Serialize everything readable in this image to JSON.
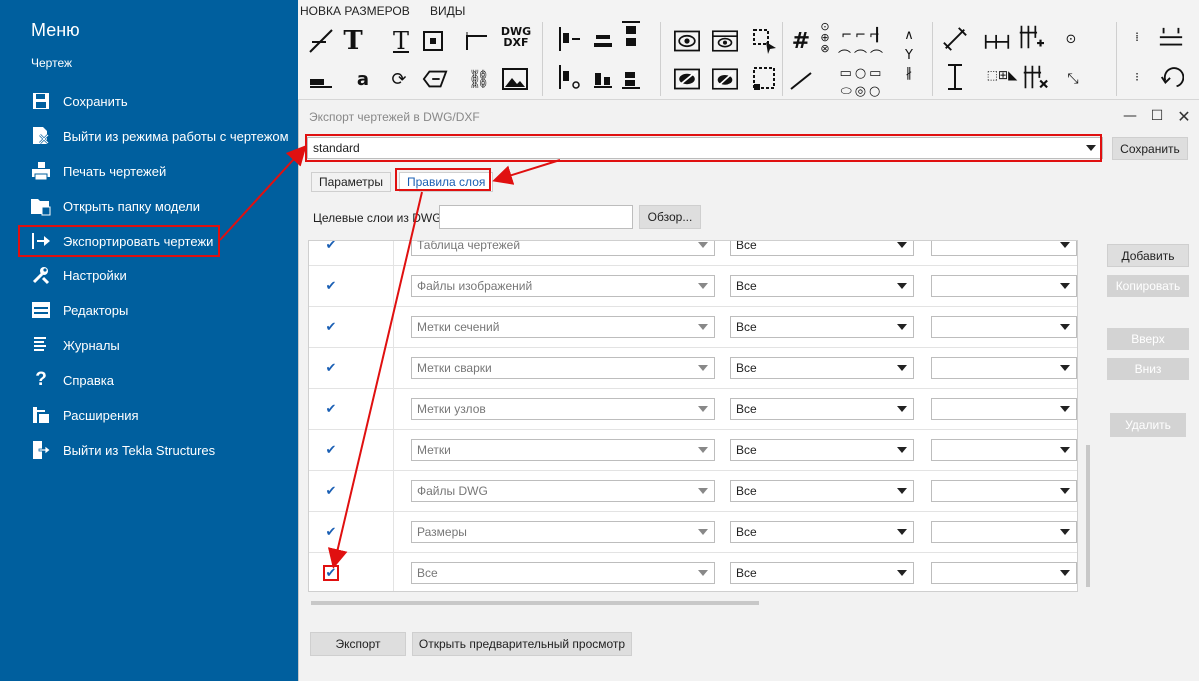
{
  "sidebar": {
    "title": "Меню",
    "section": "Чертеж",
    "items": [
      {
        "label": "Сохранить",
        "icon": "save-icon"
      },
      {
        "label": "Выйти из режима работы с чертежом",
        "icon": "exit-drawing-icon"
      },
      {
        "label": "Печать чертежей",
        "icon": "print-icon"
      },
      {
        "label": "Открыть папку модели",
        "icon": "folder-icon"
      },
      {
        "label": "Экспортировать чертежи",
        "icon": "export-icon"
      },
      {
        "label": "Настройки",
        "icon": "wrench-icon"
      },
      {
        "label": "Редакторы",
        "icon": "editors-icon"
      },
      {
        "label": "Журналы",
        "icon": "journal-icon"
      },
      {
        "label": "Справка",
        "icon": "question-icon"
      },
      {
        "label": "Расширения",
        "icon": "extensions-icon"
      },
      {
        "label": "Выйти из Tekla Structures",
        "icon": "exit-app-icon"
      }
    ]
  },
  "ribbon": {
    "tabs": [
      "НОВКА РАЗМЕРОВ",
      "ВИДЫ"
    ],
    "dwg_label": "DWG\nDXF"
  },
  "dialog": {
    "title": "Экспорт чертежей в DWG/DXF",
    "settings_value": "standard",
    "save_label": "Сохранить",
    "tabs": [
      "Параметры",
      "Правила слоя"
    ],
    "target_layers_label": "Целевые слои из DWG",
    "target_layers_value": "",
    "browse_label": "Обзор...",
    "side_buttons": {
      "add": "Добавить",
      "copy": "Копировать",
      "up": "Вверх",
      "down": "Вниз",
      "delete": "Удалить"
    },
    "rows": [
      {
        "checked": true,
        "rule": "Таблица чертежей",
        "scope": "Все",
        "extra": ""
      },
      {
        "checked": true,
        "rule": "Файлы изображений",
        "scope": "Все",
        "extra": ""
      },
      {
        "checked": true,
        "rule": "Метки сечений",
        "scope": "Все",
        "extra": ""
      },
      {
        "checked": true,
        "rule": "Метки сварки",
        "scope": "Все",
        "extra": ""
      },
      {
        "checked": true,
        "rule": "Метки узлов",
        "scope": "Все",
        "extra": ""
      },
      {
        "checked": true,
        "rule": "Метки",
        "scope": "Все",
        "extra": ""
      },
      {
        "checked": true,
        "rule": "Файлы DWG",
        "scope": "Все",
        "extra": ""
      },
      {
        "checked": true,
        "rule": "Размеры",
        "scope": "Все",
        "extra": ""
      },
      {
        "checked": true,
        "rule": "Все",
        "scope": "Все",
        "extra": ""
      }
    ],
    "export_label": "Экспорт",
    "preview_label": "Открыть предварительный просмотр"
  },
  "colors": {
    "sidebar_bg": "#005f9e",
    "callout": "#e01010",
    "active_tab": "#1a5fb4"
  }
}
